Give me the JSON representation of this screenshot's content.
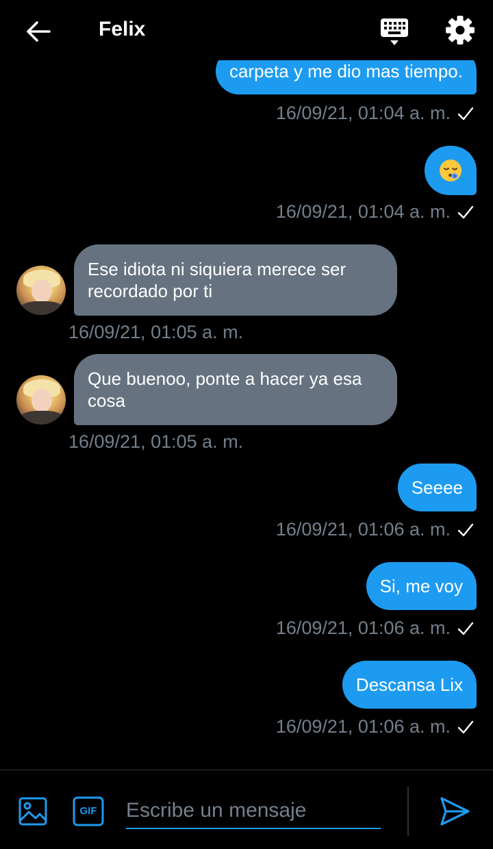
{
  "header": {
    "title": "Felix",
    "back_icon": "arrow-left-icon",
    "keyboard_icon": "keyboard-icon",
    "settings_icon": "gear-icon"
  },
  "messages": [
    {
      "direction": "out",
      "text": "carpeta y me dio mas tiempo.",
      "timestamp": "16/09/21, 01:04 a. m.",
      "read_icon": "check-icon"
    },
    {
      "direction": "out",
      "emoji": "sleepy-face",
      "timestamp": "16/09/21, 01:04 a. m.",
      "read_icon": "check-icon"
    },
    {
      "direction": "in",
      "text": "Ese idiota ni siquiera merece ser recordado por ti",
      "timestamp": "16/09/21, 01:05 a. m."
    },
    {
      "direction": "in",
      "text": "Que buenoo, ponte a hacer ya esa cosa",
      "timestamp": "16/09/21, 01:05 a. m."
    },
    {
      "direction": "out",
      "text": "Seeee",
      "timestamp": "16/09/21, 01:06 a. m.",
      "read_icon": "check-icon"
    },
    {
      "direction": "out",
      "text": "Si, me voy",
      "timestamp": "16/09/21, 01:06 a. m.",
      "read_icon": "check-icon"
    },
    {
      "direction": "out",
      "text": "Descansa Lix",
      "timestamp": "16/09/21, 01:06 a. m.",
      "read_icon": "check-icon"
    }
  ],
  "composer": {
    "placeholder": "Escribe un mensaje",
    "value": "",
    "image_icon": "image-icon",
    "gif_label": "GIF",
    "send_icon": "send-icon"
  },
  "colors": {
    "background": "#000000",
    "outgoing_bubble": "#1d9bf0",
    "incoming_bubble": "#66727f",
    "timestamp": "#73808c",
    "accent": "#1d9bf0"
  }
}
